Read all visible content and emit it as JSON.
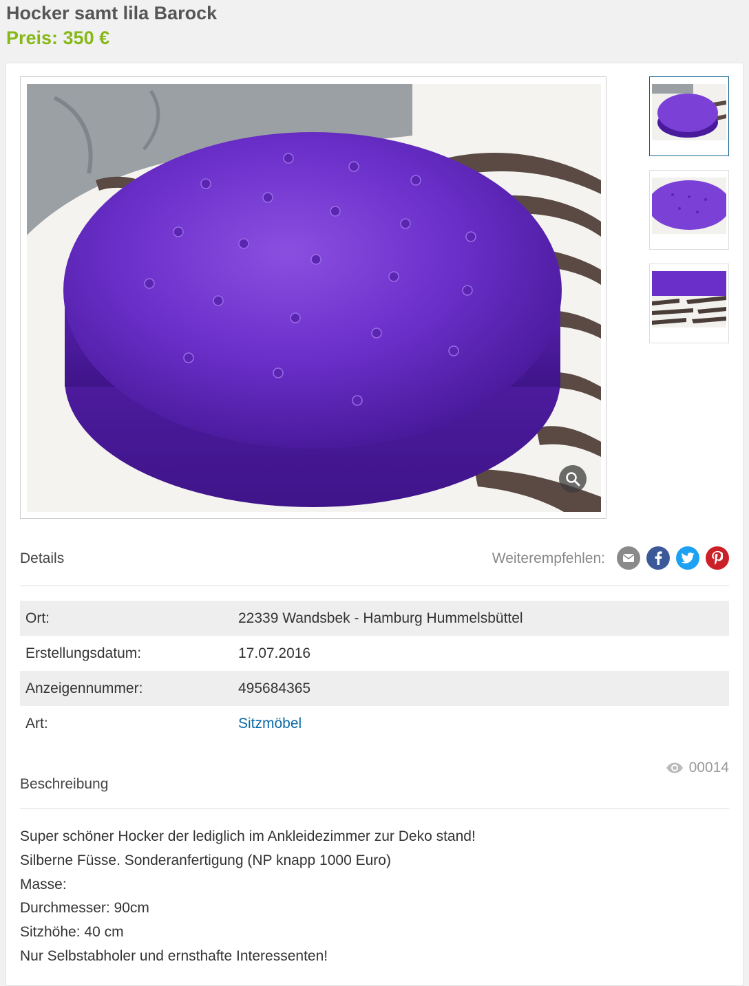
{
  "listing": {
    "title": "Hocker samt lila Barock",
    "price": "Preis: 350 €"
  },
  "gallery": {
    "thumbnails": [
      "Bild 1",
      "Bild 2",
      "Bild 3"
    ],
    "active_index": 0,
    "zoom_icon": "magnifier-icon"
  },
  "details_section": {
    "heading": "Details",
    "share_label": "Weiterempfehlen:",
    "share_icons": [
      "email-icon",
      "facebook-icon",
      "twitter-icon",
      "pinterest-icon"
    ],
    "rows": [
      {
        "key": "Ort:",
        "value": "22339 Wandsbek - Hamburg Hummelsbüttel"
      },
      {
        "key": "Erstellungsdatum:",
        "value": "17.07.2016"
      },
      {
        "key": "Anzeigennummer:",
        "value": "495684365"
      },
      {
        "key": "Art:",
        "value": "Sitzmöbel"
      }
    ]
  },
  "description_section": {
    "heading": "Beschreibung",
    "views": "00014",
    "lines": [
      "Super schöner Hocker der lediglich im Ankleidezimmer zur Deko stand!",
      "Silberne Füsse. Sonderanfertigung (NP knapp 1000 Euro)",
      "Masse:",
      "Durchmesser: 90cm",
      "Sitzhöhe: 40 cm",
      "Nur Selbstabholer und ernsthafte Interessenten!"
    ]
  },
  "colors": {
    "price": "#86b817",
    "link": "#0a6aa8",
    "email": "#8a8a8a",
    "facebook": "#3b5998",
    "twitter": "#1da1f2",
    "pinterest": "#cb2027"
  }
}
